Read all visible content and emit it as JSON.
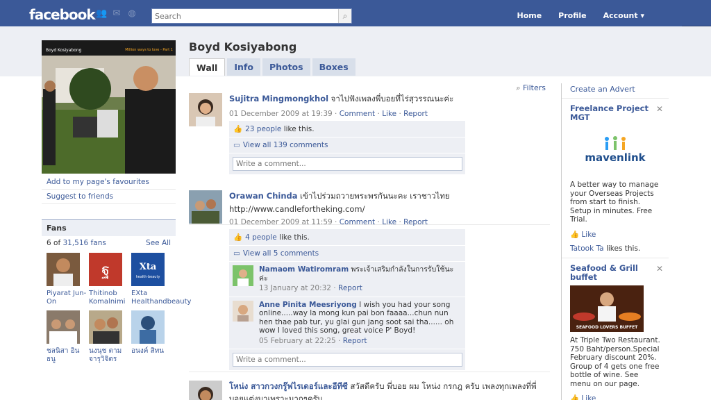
{
  "topbar": {
    "logo": "facebook",
    "search_placeholder": "Search",
    "links": [
      "Home",
      "Profile",
      "Account ▾"
    ]
  },
  "profile": {
    "name": "Boyd Kosiyabong",
    "pic_name": "Boyd Kosiyabong",
    "pic_tagline": "Million ways to love - Part 1",
    "tabs": [
      "Wall",
      "Info",
      "Photos",
      "Boxes"
    ],
    "active_tab": "Wall",
    "left_links": [
      "Add to my page's favourites",
      "Suggest to friends"
    ]
  },
  "fans": {
    "heading": "Fans",
    "count_prefix": "6 of ",
    "count_link": "31,516 fans",
    "see_all": "See All",
    "items": [
      {
        "name": "Piyarat Jun-On"
      },
      {
        "name": "Thitinob Komalnimi"
      },
      {
        "name": "EXta Healthandbeauty"
      },
      {
        "name": "ชลนิสา อินธนู"
      },
      {
        "name": "นงนุช ตามจารุวิจิตร"
      },
      {
        "name": "อนงค์ สิทน"
      }
    ]
  },
  "wall": {
    "filters": "Filters",
    "stories": [
      {
        "actor": "Sujitra Mingmongkhol",
        "message": "จาไปฟังเพลงพี่บอยที่ไร่สุวรรณนะค่ะ",
        "time": "01 December 2009 at 19:39",
        "comment": "Comment",
        "like": "Like",
        "report": "Report",
        "likes_link": "23 people",
        "likes_suffix": " like this.",
        "view_comments": "View all 139 comments",
        "write_placeholder": "Write a comment..."
      },
      {
        "actor": "Orawan Chinda",
        "message": "เข้าไปร่วมถวายพระพรกันนะคะ เราชาวไทย",
        "url": "http://www.candlefortheking.com/",
        "time": "01 December 2009 at 11:59",
        "comment": "Comment",
        "like": "Like",
        "report": "Report",
        "likes_link": "4 people",
        "likes_suffix": " like this.",
        "view_comments": "View all 5 comments",
        "comments": [
          {
            "name": "Namaom Watiromram",
            "text": "พระเจ้าเสริมกำลังในการรับใช้นะค่ะ",
            "time": "13 January at 20:32",
            "report": "Report"
          },
          {
            "name": "Anne Pinita Meesriyong",
            "text": "I wish you had your song online.....way la mong kun pai bon faaaa...chun nun hen thae pab tur, yu glai gun jang soot sai tha...... oh wow I loved this song, great voice P' Boyd!",
            "time": "05 February at 22:25",
            "report": "Report"
          }
        ],
        "write_placeholder": "Write a comment..."
      },
      {
        "actor": "โหน่ง สาวกวงกรู๊ฟไรเดอร์และอีทีซี",
        "message": "สวัสดีครับ พี่บอย ผม โหน่ง กรกฎ ครับ เพลงทุกเพลงที่พี่บอยแต่งมาเพราะมากๆครับ"
      }
    ]
  },
  "sidebar": {
    "create_advert": "Create an Advert",
    "ads": [
      {
        "title": "Freelance Project MGT",
        "brand": "mavenlink",
        "text": "A better way to manage your Overseas Projects from start to finish. Setup in minutes. Free Trial.",
        "like": "Like",
        "liker_name": "Tatook Ta",
        "liker_suffix": " likes this."
      },
      {
        "title": "Seafood & Grill buffet",
        "banner": "SEAFOOD LOVERS BUFFET",
        "text": "At Triple Two Restaurant. 750 Baht/person.Special February discount 20%. Group of 4 gets one free bottle of wine. See menu on our page.",
        "like": "Like"
      }
    ]
  }
}
